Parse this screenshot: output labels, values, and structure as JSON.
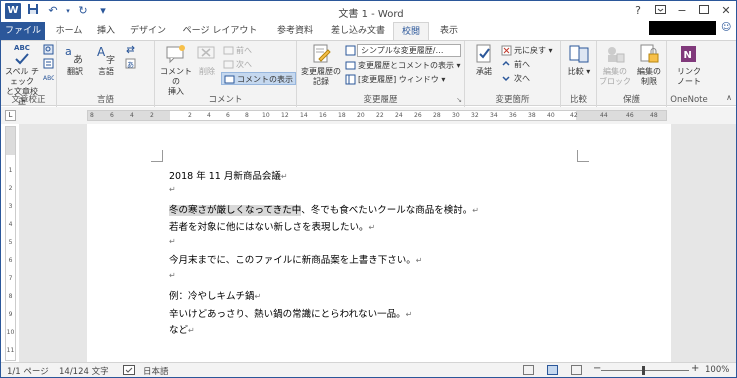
{
  "title_bar": {
    "title": "文書 1 - Word",
    "qat": [
      "W",
      "💾",
      "↶",
      "↷",
      "↻",
      "▾"
    ],
    "window_controls": [
      "?",
      "▭",
      "−",
      "▭",
      "✕"
    ]
  },
  "tabs": [
    "ファイル",
    "ホーム",
    "挿入",
    "デザイン",
    "ページ レイアウト",
    "参考資料",
    "差し込み文書",
    "校閲",
    "表示"
  ],
  "active_tab": "校閲",
  "ribbon": {
    "groups": {
      "proofing": {
        "label": "文章校正",
        "spell": "スペル チェック\nと文章校正",
        "abc": "ABC",
        "small": [
          "",
          ""
        ]
      },
      "language": {
        "label": "言語",
        "translate": "翻訳",
        "language": "言語"
      },
      "comments": {
        "label": "コメント",
        "new": "コメントの\n挿入",
        "delete": "削除",
        "prev": "前へ",
        "next": "次へ",
        "show": "コメントの表示"
      },
      "tracking": {
        "label": "変更履歴",
        "track": "変更履歴の\n記録",
        "markup_display": "シンプルな変更履歴/…",
        "show_markup": "変更履歴とコメントの表示",
        "pane": "[変更履歴] ウィンドウ"
      },
      "changes": {
        "label": "変更箇所",
        "accept": "承諾",
        "reject": "元に戻す",
        "prev": "前へ",
        "next": "次へ"
      },
      "compare": {
        "label": "比較",
        "compare": "比較"
      },
      "protect": {
        "label": "保護",
        "block": "編集の\nブロック",
        "restrict": "編集の\n制限"
      },
      "onenote": {
        "label": "OneNote",
        "link": "リンク\nノート"
      }
    }
  },
  "ruler_ticks": [
    "8",
    "6",
    "4",
    "2",
    "2",
    "4",
    "6",
    "8",
    "10",
    "12",
    "14",
    "16",
    "18",
    "20",
    "22",
    "24",
    "26",
    "28",
    "30",
    "32",
    "34",
    "36",
    "38",
    "40",
    "42",
    "44",
    "46",
    "48"
  ],
  "vruler_ticks": [
    "1",
    "2",
    "3",
    "4",
    "5",
    "6",
    "7",
    "8",
    "9",
    "10",
    "11"
  ],
  "document": {
    "lines": [
      {
        "text": "2018 年 11 月新商品会議",
        "mark": "↵"
      },
      {
        "text": "",
        "mark": "↵"
      },
      {
        "highlight": "冬の寒さが厳しくなってきた中",
        "text": "、冬でも食べたいクールな商品を検討。",
        "mark": "↵"
      },
      {
        "text": "若者を対象に他にはない新しさを表現したい。",
        "mark": "↵"
      },
      {
        "text": "",
        "mark": "↵"
      },
      {
        "text": "今月末までに、このファイルに新商品案を上書き下さい。",
        "mark": "↵"
      },
      {
        "text": "",
        "mark": "↵"
      },
      {
        "text": "例：冷やしキムチ鍋",
        "mark": "↵"
      },
      {
        "text": "辛いけどあっさり、熱い鍋の常識にとらわれない一品。",
        "mark": "↵"
      },
      {
        "text": "など",
        "mark": "↵"
      }
    ]
  },
  "status_bar": {
    "page": "1/1 ページ",
    "words": "14/124 文字",
    "language": "日本語",
    "zoom_minus": "−",
    "zoom_plus": "+",
    "zoom": "100%"
  }
}
